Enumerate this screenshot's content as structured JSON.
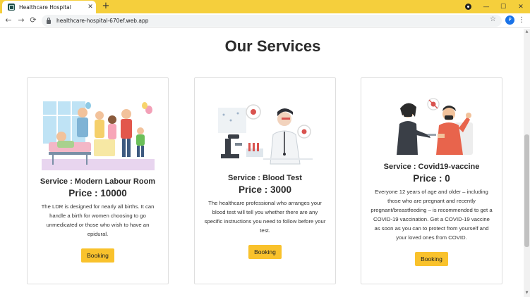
{
  "browser": {
    "tab_title": "Healthcare Hospital",
    "tab_close": "✕",
    "new_tab": "+",
    "url": "healthcare-hospital-670ef.web.app",
    "profile_initial": "P",
    "icons": {
      "back": "←",
      "forward": "→",
      "reload": "⟳",
      "star": "☆",
      "menu": "⋮",
      "minimize": "—",
      "maximize": "☐",
      "close": "✕"
    }
  },
  "page": {
    "heading": "Our Services",
    "services": [
      {
        "title": "Service : Modern Labour Room",
        "price": "Price : 10000",
        "description": "The LDR is designed for nearly all births. It can handle a birth for women choosing to go unmedicated or those who wish to have an epidural.",
        "button": "Booking"
      },
      {
        "title": "Service : Blood Test",
        "price": "Price : 3000",
        "description": "The healthcare professional who arranges your blood test will tell you whether there are any specific instructions you need to follow before your test.",
        "button": "Booking"
      },
      {
        "title": "Service : Covid19-vaccine",
        "price": "Price : 0",
        "description": "Everyone 12 years of age and older – including those who are pregnant and recently pregnant/breastfeeding – is recommended to get a COVID-19 vaccination. Get a COVID-19 vaccine as soon as you can to protect from yourself and your loved ones from COVID.",
        "button": "Booking"
      }
    ]
  },
  "colors": {
    "tabbar": "#f5cf3c",
    "button": "#f9c22c",
    "card_border": "#dedede"
  }
}
